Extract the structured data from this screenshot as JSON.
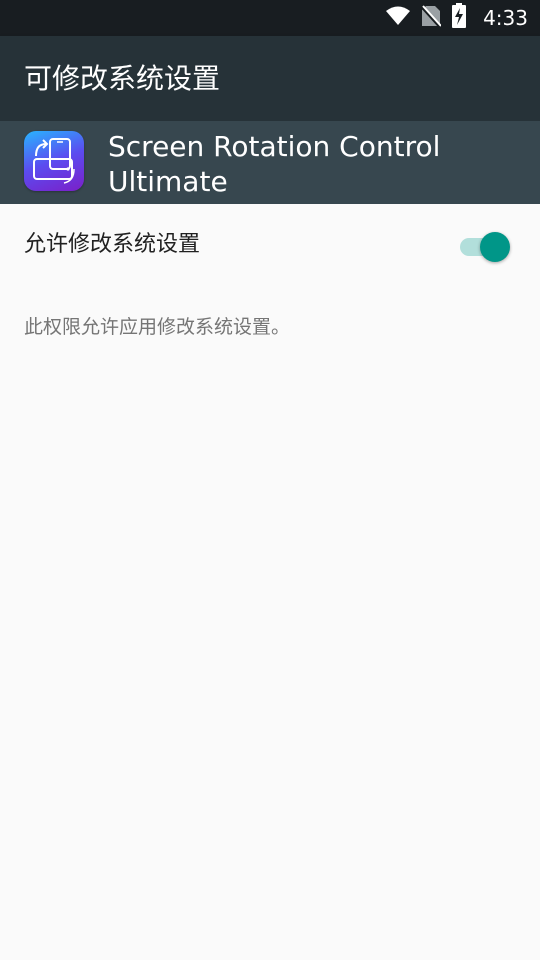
{
  "status_bar": {
    "time": "4:33",
    "icons": [
      "wifi-icon",
      "no-sim-icon",
      "battery-charging-icon"
    ]
  },
  "toolbar": {
    "title": "可修改系统设置"
  },
  "app": {
    "name": "Screen Rotation Control Ultimate",
    "icon": "screen-rotation-app-icon"
  },
  "preference": {
    "label": "允许修改系统设置",
    "enabled": true,
    "summary": "此权限允许应用修改系统设置。"
  },
  "colors": {
    "status_bar": "#181d21",
    "toolbar": "#263238",
    "app_header": "#37474f",
    "background": "#fafafa",
    "switch_thumb": "#009688",
    "switch_track": "#b2dfdb"
  }
}
